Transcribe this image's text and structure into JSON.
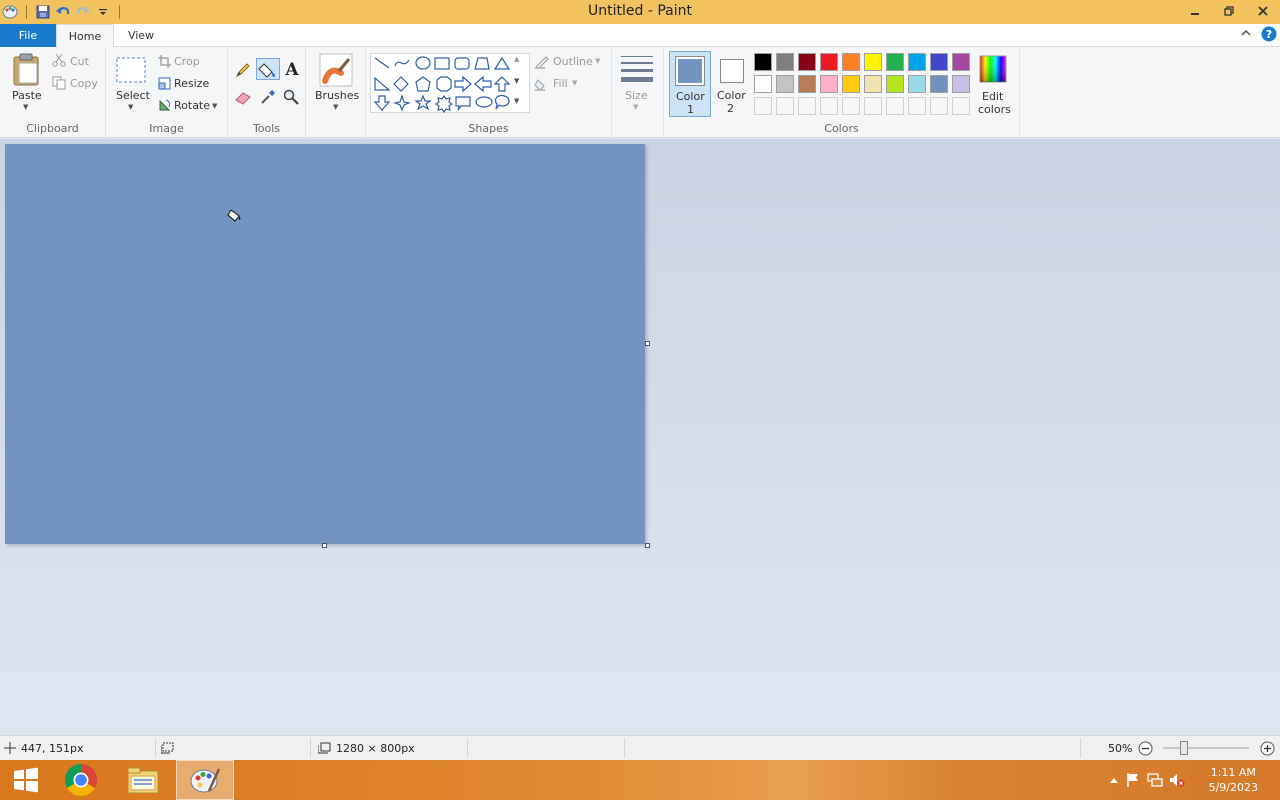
{
  "window": {
    "title": "Untitled - Paint"
  },
  "quick_access": {
    "icons": [
      "paint-app-icon",
      "save-icon",
      "undo-icon",
      "redo-icon",
      "customize-dropdown-icon"
    ]
  },
  "tabs": {
    "file": "File",
    "home": "Home",
    "view": "View"
  },
  "ribbon": {
    "clipboard": {
      "label": "Clipboard",
      "paste": "Paste",
      "cut": "Cut",
      "copy": "Copy"
    },
    "image": {
      "label": "Image",
      "select": "Select",
      "crop": "Crop",
      "resize": "Resize",
      "rotate": "Rotate"
    },
    "tools": {
      "label": "Tools",
      "selected": "fill-with-color"
    },
    "brushes": {
      "label": "Brushes"
    },
    "shapes": {
      "label": "Shapes",
      "outline": "Outline",
      "fill": "Fill"
    },
    "size": {
      "label": "Size"
    },
    "colors": {
      "label": "Colors",
      "color1_label": "Color",
      "color1_num": "1",
      "color2_label": "Color",
      "color2_num": "2",
      "color1_value": "#7393c1",
      "color2_value": "#ffffff",
      "edit_label_1": "Edit",
      "edit_label_2": "colors",
      "palette_row1": [
        "#000000",
        "#7f7f7f",
        "#880015",
        "#ed1c24",
        "#ff7f27",
        "#fff200",
        "#22b14c",
        "#00a2e8",
        "#3f48cc",
        "#a349a4"
      ],
      "palette_row2": [
        "#ffffff",
        "#c3c3c3",
        "#b97a57",
        "#ffaec9",
        "#ffc90e",
        "#efe4b0",
        "#b5e61d",
        "#99d9ea",
        "#7092be",
        "#c8bfe7"
      ]
    }
  },
  "canvas": {
    "fill_color": "#7393c1"
  },
  "status": {
    "cursor_pos": "447, 151px",
    "image_size": "1280 × 800px",
    "zoom": "50%"
  },
  "taskbar": {
    "time": "1:11 AM",
    "date": "5/9/2023"
  }
}
